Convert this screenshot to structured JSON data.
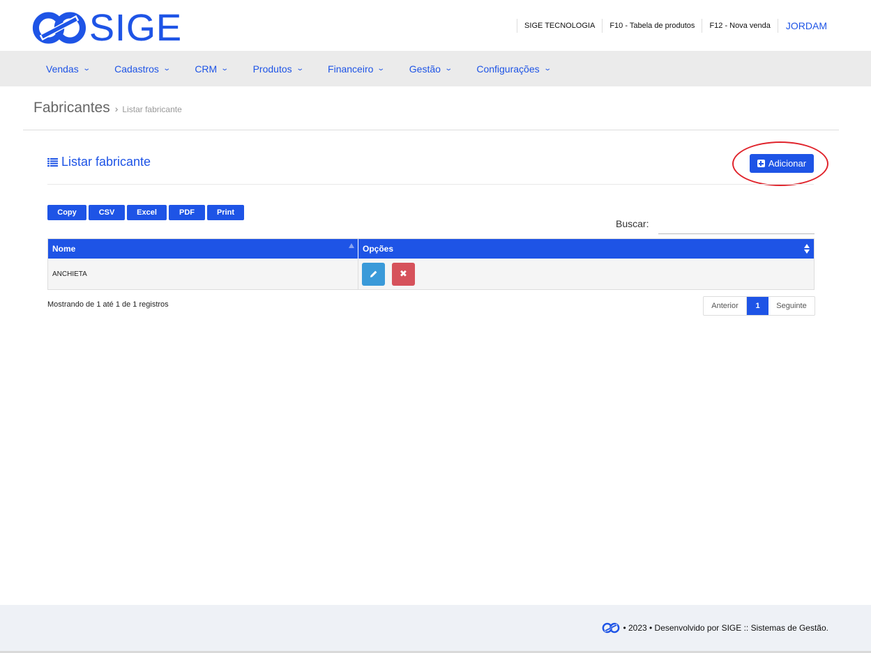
{
  "brand": {
    "name": "SIGE",
    "color": "#1e54e6"
  },
  "header": {
    "links": [
      "SIGE TECNOLOGIA",
      "F10 - Tabela de produtos",
      "F12 - Nova venda"
    ],
    "user": "JORDAM"
  },
  "nav": {
    "items": [
      "Vendas",
      "Cadastros",
      "CRM",
      "Produtos",
      "Financeiro",
      "Gestão",
      "Configurações"
    ]
  },
  "breadcrumb": {
    "title": "Fabricantes",
    "separator": "›",
    "current": "Listar fabricante"
  },
  "panel": {
    "title": "Listar fabricante",
    "add_label": "Adicionar"
  },
  "exports": [
    "Copy",
    "CSV",
    "Excel",
    "PDF",
    "Print"
  ],
  "search": {
    "label": "Buscar:",
    "value": ""
  },
  "table": {
    "columns": [
      "Nome",
      "Opções"
    ],
    "rows": [
      {
        "name": "ANCHIETA"
      }
    ]
  },
  "info": "Mostrando de 1 até 1 de 1 registros",
  "pagination": {
    "prev": "Anterior",
    "current": "1",
    "next": "Seguinte"
  },
  "footer": {
    "text": "• 2023 • Desenvolvido por SIGE :: Sistemas de Gestão."
  },
  "colors": {
    "primary": "#1e54e6",
    "edit": "#3a9ad9",
    "delete": "#d6525b",
    "highlight": "#e0242c"
  }
}
